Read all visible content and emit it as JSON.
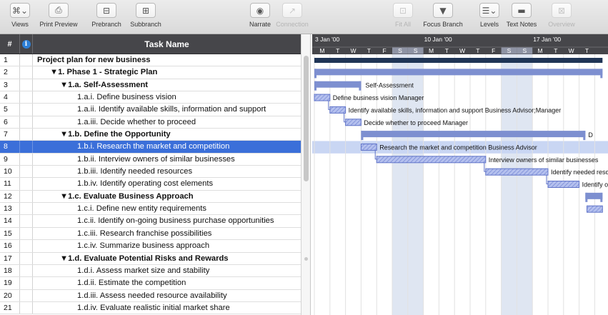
{
  "toolbar": {
    "left_buttons": [
      {
        "label": "Views",
        "icon": "views-icon",
        "glyph": "⌘⌄",
        "disabled": false
      },
      {
        "label": "Print Preview",
        "icon": "printer-icon",
        "glyph": "⎙",
        "disabled": false
      },
      {
        "label": "Prebranch",
        "icon": "prebranch-icon",
        "glyph": "⊟",
        "disabled": false
      },
      {
        "label": "Subbranch",
        "icon": "subbranch-icon",
        "glyph": "⊞",
        "disabled": false
      }
    ],
    "mid_buttons": [
      {
        "label": "Narrate",
        "icon": "narrate-icon",
        "glyph": "◉",
        "disabled": false
      },
      {
        "label": "Connection",
        "icon": "connection-icon",
        "glyph": "↗",
        "disabled": true
      }
    ],
    "right_buttons": [
      {
        "label": "Fit All",
        "icon": "fit-all-icon",
        "glyph": "⊡",
        "disabled": true
      },
      {
        "label": "Focus Branch",
        "icon": "focus-branch-icon",
        "glyph": "▼",
        "disabled": false
      },
      {
        "label": "Levels",
        "icon": "levels-icon",
        "glyph": "☰⌄",
        "disabled": false
      },
      {
        "label": "Text Notes",
        "icon": "text-notes-icon",
        "glyph": "▬",
        "disabled": false
      },
      {
        "label": "Overview",
        "icon": "overview-icon",
        "glyph": "⊠",
        "disabled": true
      }
    ]
  },
  "outline": {
    "header": {
      "number": "#",
      "info": "i",
      "task_name": "Task Name"
    },
    "rows": [
      {
        "num": "1",
        "title": "Project plan for new business",
        "level": 0,
        "bold": true,
        "selected": false
      },
      {
        "num": "2",
        "title": "▼1. Phase 1 - Strategic Plan",
        "level": 1,
        "bold": true,
        "selected": false
      },
      {
        "num": "3",
        "title": "▼1.a. Self-Assessment",
        "level": 2,
        "bold": true,
        "selected": false
      },
      {
        "num": "4",
        "title": "1.a.i. Define business vision",
        "level": 3,
        "bold": false,
        "selected": false
      },
      {
        "num": "5",
        "title": "1.a.ii. Identify available skills, information and support",
        "level": 3,
        "bold": false,
        "selected": false
      },
      {
        "num": "6",
        "title": "1.a.iii. Decide whether to proceed",
        "level": 3,
        "bold": false,
        "selected": false
      },
      {
        "num": "7",
        "title": "▼1.b. Define the Opportunity",
        "level": 2,
        "bold": true,
        "selected": false
      },
      {
        "num": "8",
        "title": "1.b.i. Research the market and competition",
        "level": 3,
        "bold": false,
        "selected": true
      },
      {
        "num": "9",
        "title": "1.b.ii. Interview owners of similar businesses",
        "level": 3,
        "bold": false,
        "selected": false
      },
      {
        "num": "10",
        "title": "1.b.iii. Identify needed resources",
        "level": 3,
        "bold": false,
        "selected": false
      },
      {
        "num": "11",
        "title": "1.b.iv. Identify operating cost elements",
        "level": 3,
        "bold": false,
        "selected": false
      },
      {
        "num": "12",
        "title": "▼1.c. Evaluate Business Approach",
        "level": 2,
        "bold": true,
        "selected": false
      },
      {
        "num": "13",
        "title": "1.c.i. Define new entity requirements",
        "level": 3,
        "bold": false,
        "selected": false
      },
      {
        "num": "14",
        "title": "1.c.ii. Identify on-going business purchase opportunities",
        "level": 3,
        "bold": false,
        "selected": false
      },
      {
        "num": "15",
        "title": "1.c.iii. Research franchise possibilities",
        "level": 3,
        "bold": false,
        "selected": false
      },
      {
        "num": "16",
        "title": "1.c.iv. Summarize business approach",
        "level": 3,
        "bold": false,
        "selected": false
      },
      {
        "num": "17",
        "title": "▼1.d. Evaluate Potential Risks and Rewards",
        "level": 2,
        "bold": true,
        "selected": false
      },
      {
        "num": "18",
        "title": "1.d.i. Assess market size and stability",
        "level": 3,
        "bold": false,
        "selected": false
      },
      {
        "num": "19",
        "title": "1.d.ii. Estimate the competition",
        "level": 3,
        "bold": false,
        "selected": false
      },
      {
        "num": "20",
        "title": "1.d.iii. Assess needed resource availability",
        "level": 3,
        "bold": false,
        "selected": false
      },
      {
        "num": "21",
        "title": "1.d.iv. Evaluate realistic initial market share",
        "level": 3,
        "bold": false,
        "selected": false
      }
    ]
  },
  "gantt": {
    "week_labels": [
      "3 Jan '00",
      "10 Jan '00",
      "17 Jan '00"
    ],
    "day_letters": [
      "M",
      "T",
      "W",
      "T",
      "F",
      "S",
      "S",
      "M",
      "T",
      "W",
      "T",
      "F",
      "S",
      "S",
      "M",
      "T",
      "W",
      "T"
    ],
    "weekend_days": [
      5,
      6,
      12,
      13
    ],
    "colors": {
      "summary": "#1f3556",
      "phase": "#7d8fd0",
      "task": "#8f9fe0",
      "weekend": "#dfe6f2",
      "selected_row": "#3b6fd9"
    },
    "bars": [
      {
        "row": 1,
        "type": "summary",
        "start_day": 0,
        "end_day": 18.5
      },
      {
        "row": 2,
        "type": "phase",
        "start_day": 0,
        "end_day": 18.5
      },
      {
        "row": 3,
        "type": "phase",
        "start_day": 0,
        "end_day": 3.0,
        "label": "Self-Assessment"
      },
      {
        "row": 4,
        "type": "task",
        "start_day": 0,
        "end_day": 1.0,
        "label": "Define business vision  Manager"
      },
      {
        "row": 5,
        "type": "task",
        "start_day": 1.0,
        "end_day": 2.0,
        "label": "Identify available skills, information and support  Business Advisor;Manager"
      },
      {
        "row": 6,
        "type": "task",
        "start_day": 2.0,
        "end_day": 3.0,
        "label": "Decide whether to proceed  Manager"
      },
      {
        "row": 7,
        "type": "phase",
        "start_day": 3.0,
        "end_day": 17.4,
        "label": "D"
      },
      {
        "row": 8,
        "type": "task",
        "start_day": 3.0,
        "end_day": 4.0,
        "label": "Research the market and competition  Business Advisor"
      },
      {
        "row": 9,
        "type": "task",
        "start_day": 4.0,
        "end_day": 11.0,
        "label": "Interview owners of similar businesses"
      },
      {
        "row": 10,
        "type": "task",
        "start_day": 11.0,
        "end_day": 15.0,
        "label": "Identify needed resources"
      },
      {
        "row": 11,
        "type": "task",
        "start_day": 15.0,
        "end_day": 17.0,
        "label": "Identify operating cost elements"
      },
      {
        "row": 12,
        "type": "phase",
        "start_day": 17.4,
        "end_day": 18.5
      },
      {
        "row": 13,
        "type": "task",
        "start_day": 17.5,
        "end_day": 18.5
      }
    ]
  }
}
